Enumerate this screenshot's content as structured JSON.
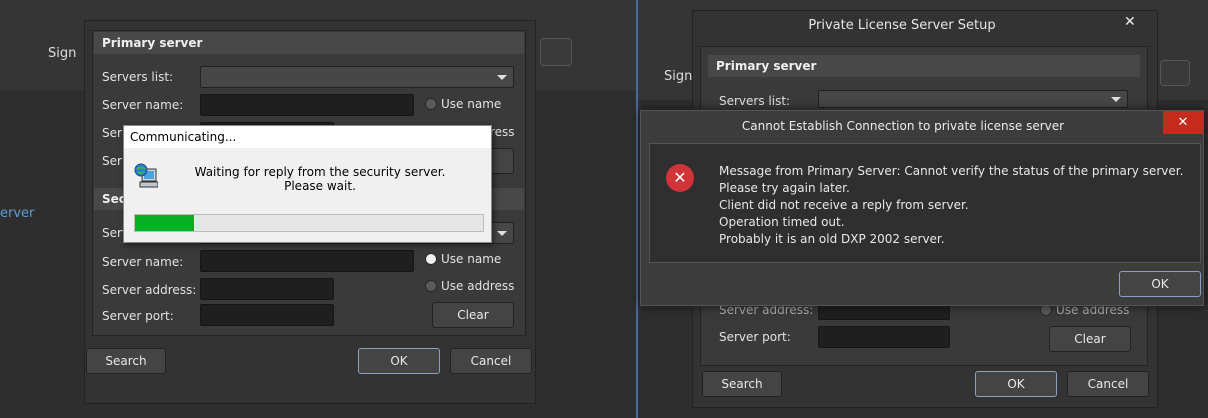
{
  "left": {
    "sign_label": "Sign",
    "side_label": "erver",
    "primary": {
      "header": "Primary server",
      "servers_list_label": "Servers list:",
      "server_name_label": "Server name:",
      "server_address_label": "Ser",
      "server_port_label": "Ser",
      "use_name_label": "Use name",
      "use_address_label": "ress"
    },
    "secondary": {
      "header": "Seco",
      "servers_list_label": "Serv",
      "server_name_label": "Server name:",
      "server_address_label": "Server address:",
      "server_port_label": "Server port:",
      "use_name_label": "Use name",
      "use_address_label": "Use address",
      "clear_label": "Clear"
    },
    "buttons": {
      "search": "Search",
      "ok": "OK",
      "cancel": "Cancel"
    },
    "communicating": {
      "title": "Communicating...",
      "message_line1": "Waiting for reply from the security server.",
      "message_line2": "Please wait.",
      "progress": 0.17
    }
  },
  "right": {
    "dialog_title": "Private License Server Setup",
    "close_glyph": "✕",
    "sign_label": "Sign",
    "primary": {
      "header": "Primary server",
      "servers_list_label": "Servers list:"
    },
    "secondary": {
      "server_address_label": "Server address:",
      "server_port_label": "Server port:",
      "use_address_label": "Use address",
      "clear_label": "Clear"
    },
    "buttons": {
      "search": "Search",
      "ok": "OK",
      "cancel": "Cancel"
    },
    "error": {
      "title": "Cannot Establish Connection to private license server",
      "close_glyph": "✕",
      "icon_glyph": "✕",
      "lines": [
        "Message from Primary Server: Cannot verify the status of the primary server.",
        "Please try again later.",
        "Client did not receive a reply from server.",
        "Operation timed out.",
        "Probably it is an old DXP 2002 server."
      ],
      "ok": "OK"
    }
  },
  "colors": {
    "accent_green": "#06b025",
    "error_red": "#d13438",
    "close_red": "#c42b1c"
  }
}
